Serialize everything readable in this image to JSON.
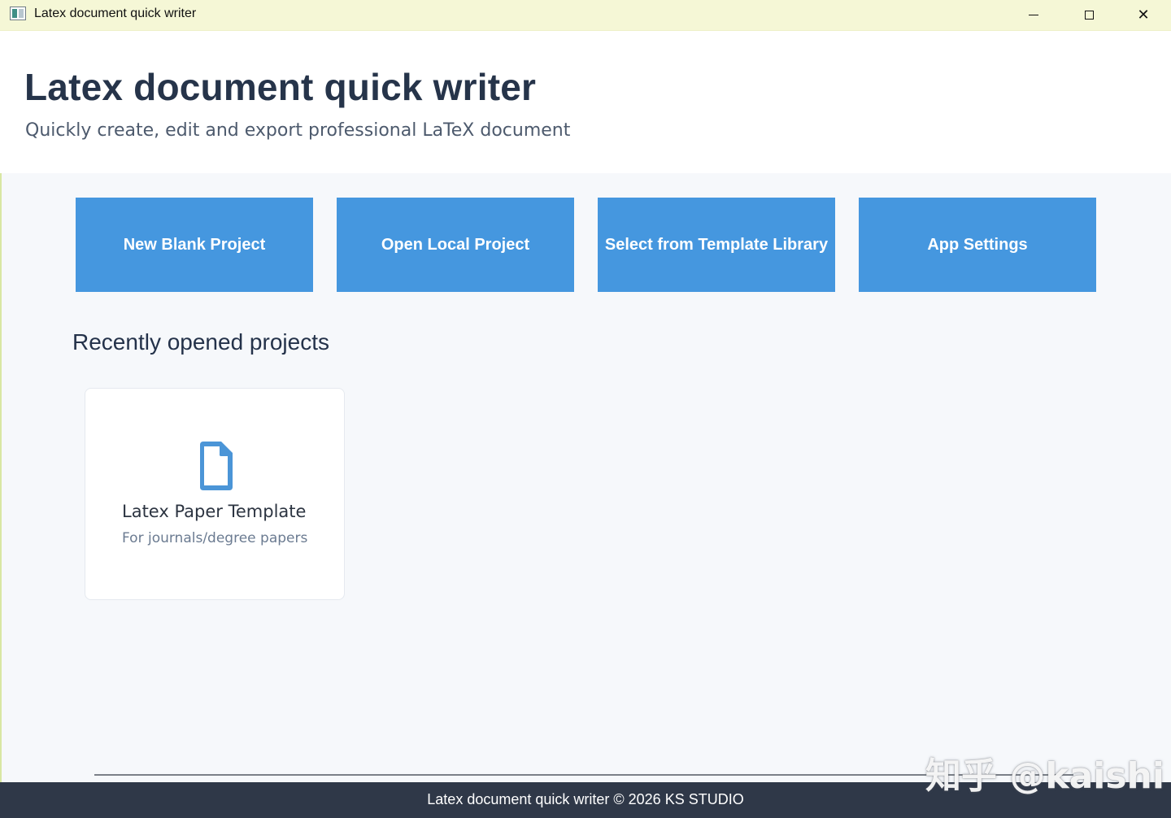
{
  "window": {
    "title": "Latex document quick writer",
    "controls": {
      "minimize": "minimize",
      "maximize": "maximize",
      "close": "✕"
    }
  },
  "header": {
    "title": "Latex document quick writer",
    "subtitle": "Quickly create, edit and export professional LaTeX document"
  },
  "actions": [
    {
      "label": "New Blank Project"
    },
    {
      "label": "Open Local Project"
    },
    {
      "label": "Select from Template Library"
    },
    {
      "label": "App Settings"
    }
  ],
  "recent": {
    "title": "Recently opened projects",
    "projects": [
      {
        "title": "Latex Paper Template",
        "subtitle": "For journals/degree papers",
        "icon": "document-icon"
      }
    ]
  },
  "footer": {
    "text": "Latex document quick writer © 2026 KS STUDIO"
  },
  "watermark": {
    "text": "知乎 @kaishi"
  },
  "colors": {
    "accent": "#4597df",
    "header_text": "#26344a",
    "footer_bg": "#2f3848",
    "background": "#f6f8fb",
    "titlebar_bg": "#f5f7d6"
  }
}
